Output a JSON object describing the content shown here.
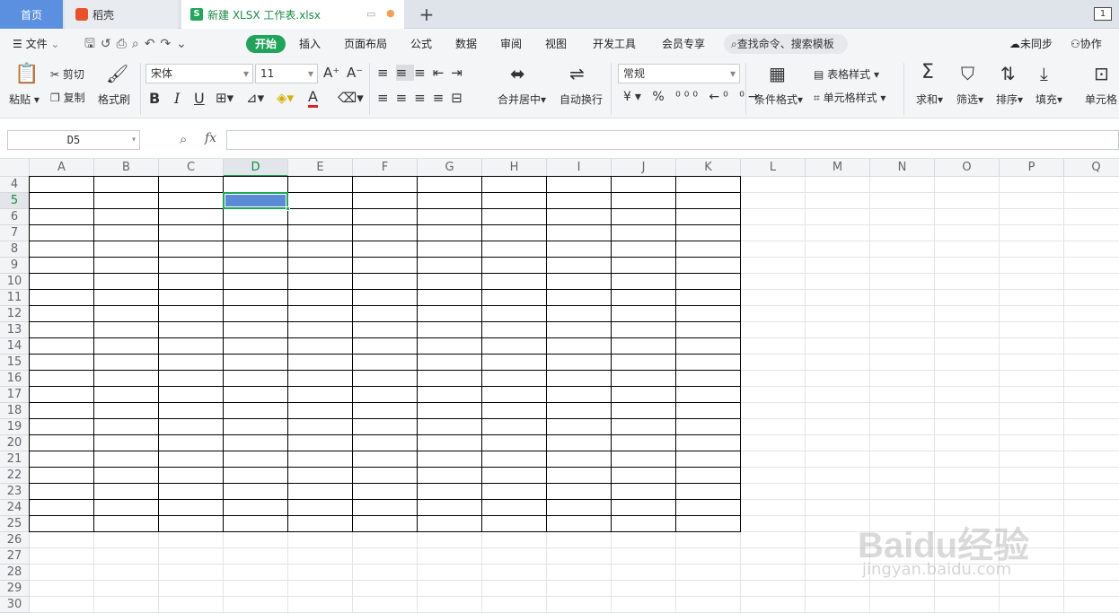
{
  "tabs": {
    "home": "首页",
    "docer": "稻壳",
    "document": "新建 XLSX 工作表.xlsx",
    "add": "+",
    "window_count": "1"
  },
  "menu": {
    "file": "文件",
    "items": [
      "开始",
      "插入",
      "页面布局",
      "公式",
      "数据",
      "审阅",
      "视图",
      "开发工具",
      "会员专享"
    ],
    "search": "查找命令、搜索模板",
    "sync": "未同步",
    "collab": "协作"
  },
  "ribbon": {
    "paste": "粘贴",
    "cut": "剪切",
    "copy": "复制",
    "format_painter": "格式刷",
    "font_name": "宋体",
    "font_size": "11",
    "merge_center": "合并居中",
    "wrap_text": "自动换行",
    "number_format": "常规",
    "cond_format": "条件格式",
    "table_style": "表格样式",
    "cell_style": "单元格样式",
    "sum": "求和",
    "filter": "筛选",
    "sort": "排序",
    "fill": "填充",
    "cell": "单元格"
  },
  "formula": {
    "cell_ref": "D5",
    "fx": "fx",
    "value": ""
  },
  "sheet": {
    "columns": [
      "A",
      "B",
      "C",
      "D",
      "E",
      "F",
      "G",
      "H",
      "I",
      "J",
      "K",
      "L",
      "M",
      "N",
      "O",
      "P",
      "Q"
    ],
    "rows": [
      "4",
      "5",
      "6",
      "7",
      "8",
      "9",
      "10",
      "11",
      "12",
      "13",
      "14",
      "15",
      "16",
      "17",
      "18",
      "19",
      "20",
      "21",
      "22",
      "23",
      "24",
      "25",
      "26",
      "27",
      "28",
      "29",
      "30"
    ],
    "selected_cell": "D5",
    "bordered_range": "A4:K25",
    "selection_color": "#5b8ad6",
    "accent_color": "#22a35b"
  },
  "watermark": {
    "logo": "Baidu经验",
    "url": "jingyan.baidu.com"
  }
}
